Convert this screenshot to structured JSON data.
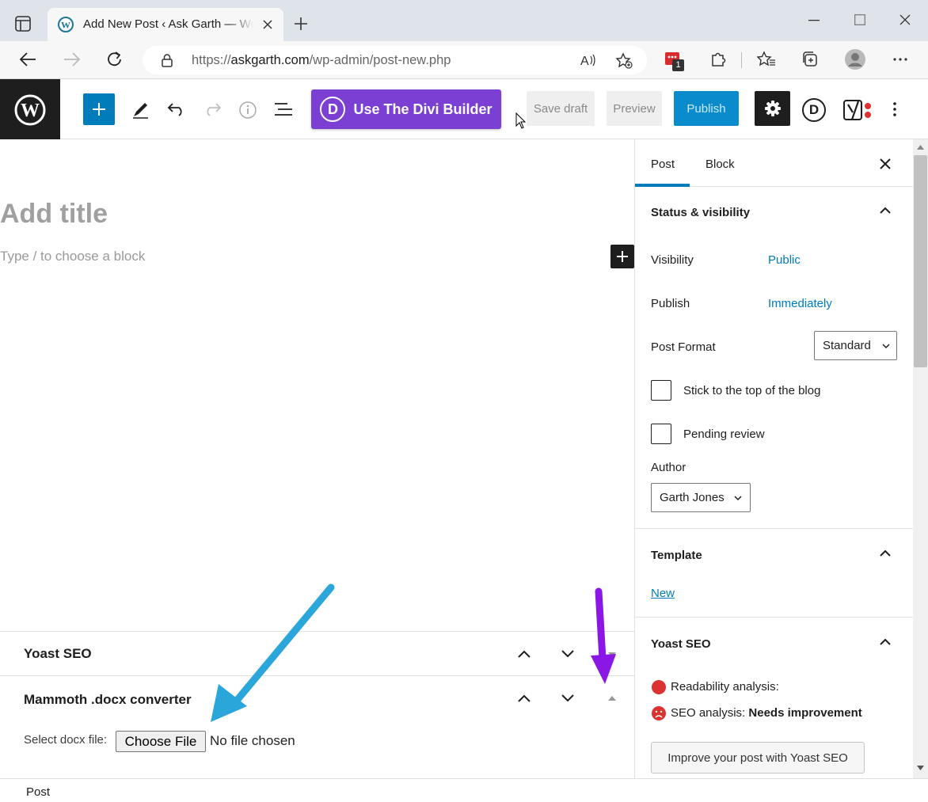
{
  "browser": {
    "tab_title": "Add New Post ‹ Ask Garth — WordPress",
    "url_prefix": "https://",
    "url_domain": "askgarth.com",
    "url_path": "/wp-admin/post-new.php",
    "extension_badge": "1"
  },
  "toolbar": {
    "divi_button_letter": "D",
    "divi_button_label": "Use The Divi Builder",
    "save_draft_label": "Save draft",
    "preview_label": "Preview",
    "publish_label": "Publish",
    "divi_icon_letter": "D"
  },
  "editor": {
    "title_placeholder": "Add title",
    "block_placeholder": "Type / to choose a block"
  },
  "metaboxes": {
    "yoast_title": "Yoast SEO",
    "mammoth_title": "Mammoth .docx converter",
    "select_label": "Select docx file:",
    "choose_file_label": "Choose File",
    "no_file_text": "No file chosen"
  },
  "sidebar": {
    "tabs": [
      "Post",
      "Block"
    ],
    "status_title": "Status & visibility",
    "visibility_label": "Visibility",
    "visibility_value": "Public",
    "publish_label": "Publish",
    "publish_value": "Immediately",
    "post_format_label": "Post Format",
    "post_format_value": "Standard",
    "sticky_label": "Stick to the top of the blog",
    "pending_label": "Pending review",
    "author_label": "Author",
    "author_value": "Garth Jones",
    "template_title": "Template",
    "template_link": "New",
    "yoast_title": "Yoast SEO",
    "readability_label": "Readability analysis:",
    "seo_label": "SEO analysis:",
    "seo_value": "Needs improvement",
    "improve_button": "Improve your post with Yoast SEO"
  },
  "footer": {
    "breadcrumb": "Post"
  },
  "colors": {
    "accent": "#007cba",
    "divi_purple": "#7b3fd4",
    "arrow_blue": "#2aa6db",
    "arrow_purple": "#8a17e6",
    "yoast_red": "#dc3232"
  }
}
